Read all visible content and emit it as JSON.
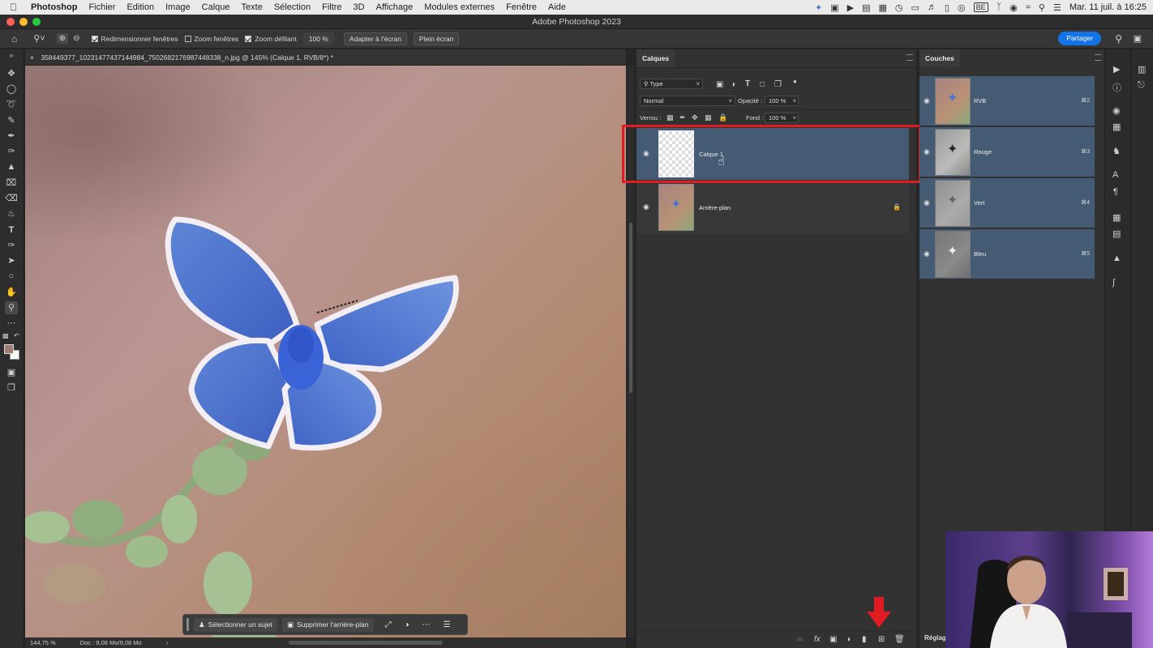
{
  "menubar": {
    "app_name": "Photoshop",
    "items": [
      "Fichier",
      "Edition",
      "Image",
      "Calque",
      "Texte",
      "Sélection",
      "Filtre",
      "3D",
      "Affichage",
      "Modules externes",
      "Fenêtre",
      "Aide"
    ],
    "language_badge": "BE",
    "datetime": "Mar. 11 juil. à 16:25"
  },
  "window": {
    "title": "Adobe Photoshop 2023"
  },
  "options": {
    "resize_windows_label": "Redimensionner fenêtres",
    "resize_windows_checked": true,
    "zoom_windows_label": "Zoom fenêtres",
    "zoom_windows_checked": false,
    "scrubby_zoom_label": "Zoom défilant",
    "scrubby_zoom_checked": true,
    "zoom_value": "100 %",
    "fit_screen_label": "Adapter à l'écran",
    "full_screen_label": "Plein écran",
    "share_label": "Partager"
  },
  "document": {
    "tab_title": "358449377_10231477437144984_7502682176987448338_n.jpg @ 145% (Calque 1, RVB/8*) *",
    "zoom_status": "144,75 %",
    "doc_info": "Doc : 9,08 Mo/9,08 Mo"
  },
  "contextbar": {
    "select_subject": "Sélectionner un sujet",
    "remove_background": "Supprimer l'arrière-plan"
  },
  "layers_panel": {
    "tab": "Calques",
    "filter_kind": "Type",
    "blend_mode": "Normal",
    "opacity_label": "Opacité :",
    "opacity_value": "100 %",
    "lock_label": "Verrou :",
    "fill_label": "Fond :",
    "fill_value": "100 %",
    "layers": [
      {
        "name": "Calque 1",
        "selected": true,
        "locked": false
      },
      {
        "name": "Arrière-plan",
        "selected": false,
        "locked": true
      }
    ]
  },
  "channels_panel": {
    "tab": "Couches",
    "channels": [
      {
        "name": "RVB",
        "shortcut": "⌘2"
      },
      {
        "name": "Rouge",
        "shortcut": "⌘3"
      },
      {
        "name": "Vert",
        "shortcut": "⌘4"
      },
      {
        "name": "Bleu",
        "shortcut": "⌘5"
      }
    ]
  },
  "adjustments_tab": "Réglag",
  "colors": {
    "accent": "#1473e6",
    "selection": "#455a73",
    "highlight": "#e11b22"
  }
}
